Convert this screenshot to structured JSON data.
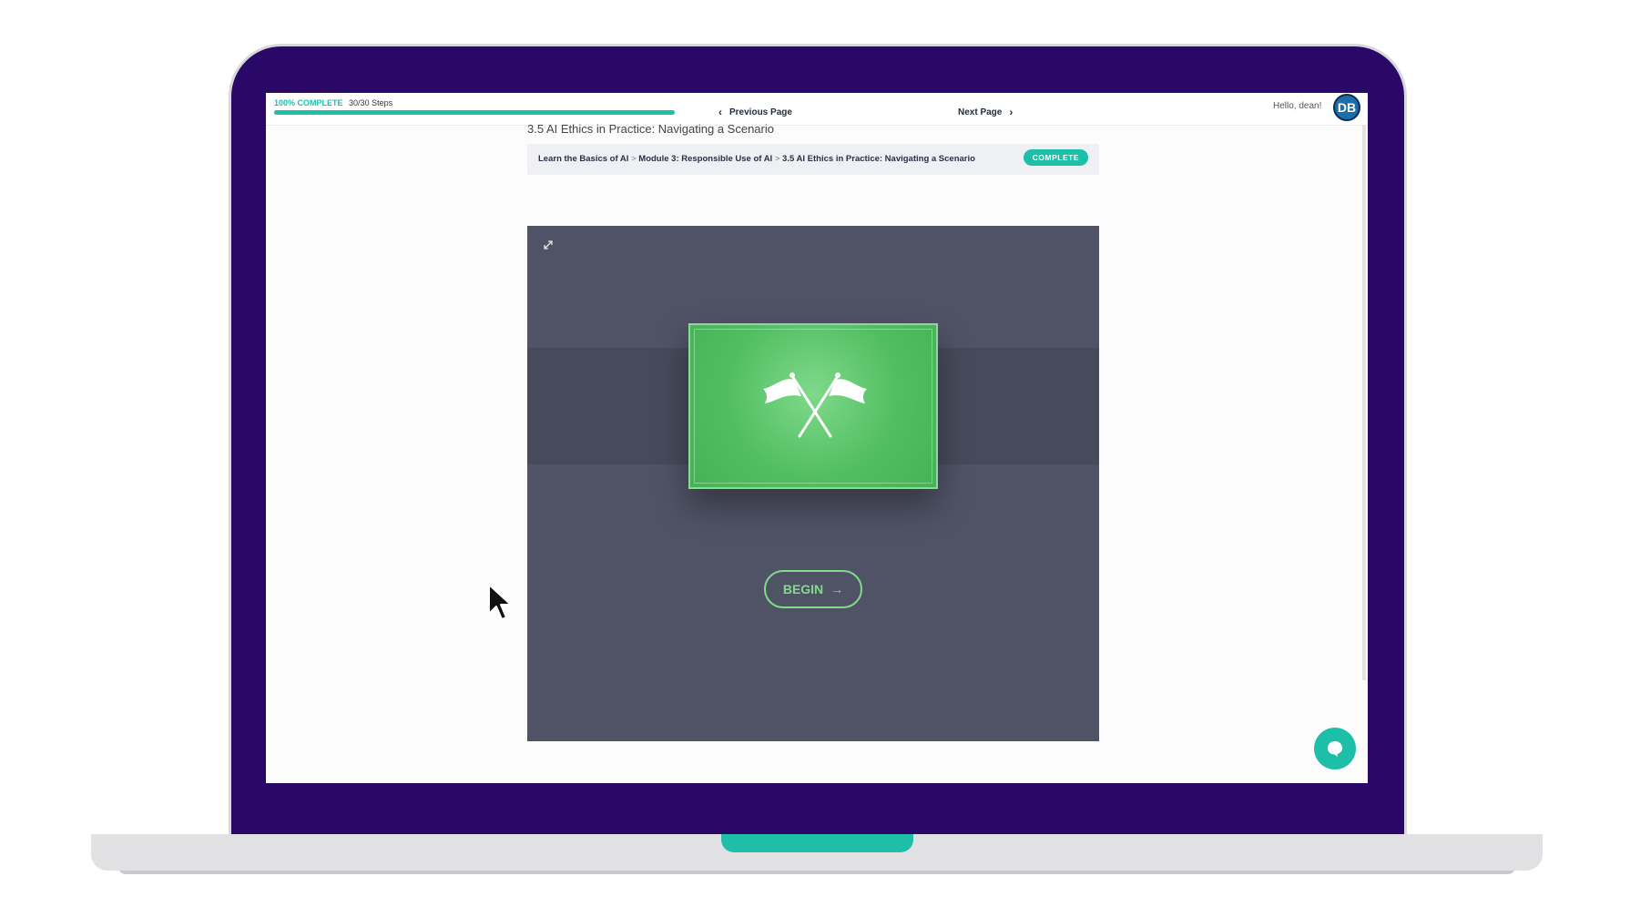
{
  "progress": {
    "percent_label": "100% COMPLETE",
    "steps_label": "30/30 Steps",
    "value": 1.0
  },
  "nav": {
    "previous_label": "Previous Page",
    "next_label": "Next Page"
  },
  "user": {
    "greeting": "Hello, dean!",
    "initials": "DB"
  },
  "lesson": {
    "title": "3.5 AI Ethics in Practice: Navigating a Scenario",
    "breadcrumb": [
      "Learn the Basics of AI",
      "Module 3: Responsible Use of AI",
      "3.5 AI Ethics in Practice: Navigating a Scenario"
    ],
    "breadcrumb_separator": ">",
    "status_badge": "COMPLETE"
  },
  "player": {
    "begin_label": "BEGIN",
    "begin_arrow": "→",
    "hero_icon": "crossed-flags-icon",
    "expand_icon": "expand-icon"
  },
  "chat": {
    "icon": "chat-bubble-icon"
  },
  "colors": {
    "accent": "#1dbfa8",
    "laptop_frame": "#2a0868",
    "player_bg": "#505366",
    "hero_green": "#52be62",
    "begin_green": "#7fdc8a"
  }
}
